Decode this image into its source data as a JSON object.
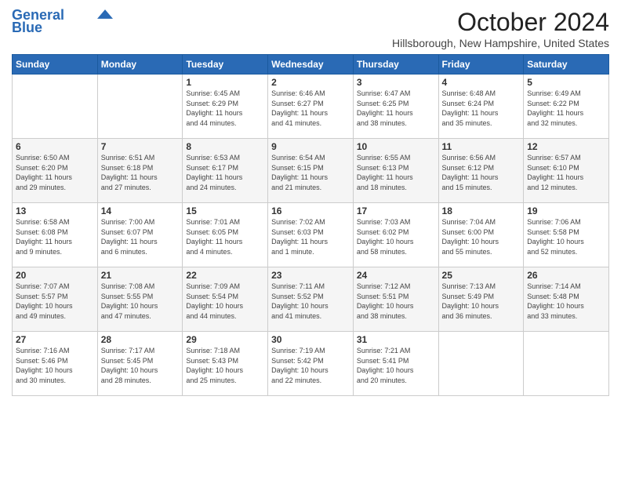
{
  "header": {
    "logo_line1": "General",
    "logo_line2": "Blue",
    "month": "October 2024",
    "location": "Hillsborough, New Hampshire, United States"
  },
  "days_of_week": [
    "Sunday",
    "Monday",
    "Tuesday",
    "Wednesday",
    "Thursday",
    "Friday",
    "Saturday"
  ],
  "weeks": [
    [
      {
        "day": "",
        "info": ""
      },
      {
        "day": "",
        "info": ""
      },
      {
        "day": "1",
        "info": "Sunrise: 6:45 AM\nSunset: 6:29 PM\nDaylight: 11 hours\nand 44 minutes."
      },
      {
        "day": "2",
        "info": "Sunrise: 6:46 AM\nSunset: 6:27 PM\nDaylight: 11 hours\nand 41 minutes."
      },
      {
        "day": "3",
        "info": "Sunrise: 6:47 AM\nSunset: 6:25 PM\nDaylight: 11 hours\nand 38 minutes."
      },
      {
        "day": "4",
        "info": "Sunrise: 6:48 AM\nSunset: 6:24 PM\nDaylight: 11 hours\nand 35 minutes."
      },
      {
        "day": "5",
        "info": "Sunrise: 6:49 AM\nSunset: 6:22 PM\nDaylight: 11 hours\nand 32 minutes."
      }
    ],
    [
      {
        "day": "6",
        "info": "Sunrise: 6:50 AM\nSunset: 6:20 PM\nDaylight: 11 hours\nand 29 minutes."
      },
      {
        "day": "7",
        "info": "Sunrise: 6:51 AM\nSunset: 6:18 PM\nDaylight: 11 hours\nand 27 minutes."
      },
      {
        "day": "8",
        "info": "Sunrise: 6:53 AM\nSunset: 6:17 PM\nDaylight: 11 hours\nand 24 minutes."
      },
      {
        "day": "9",
        "info": "Sunrise: 6:54 AM\nSunset: 6:15 PM\nDaylight: 11 hours\nand 21 minutes."
      },
      {
        "day": "10",
        "info": "Sunrise: 6:55 AM\nSunset: 6:13 PM\nDaylight: 11 hours\nand 18 minutes."
      },
      {
        "day": "11",
        "info": "Sunrise: 6:56 AM\nSunset: 6:12 PM\nDaylight: 11 hours\nand 15 minutes."
      },
      {
        "day": "12",
        "info": "Sunrise: 6:57 AM\nSunset: 6:10 PM\nDaylight: 11 hours\nand 12 minutes."
      }
    ],
    [
      {
        "day": "13",
        "info": "Sunrise: 6:58 AM\nSunset: 6:08 PM\nDaylight: 11 hours\nand 9 minutes."
      },
      {
        "day": "14",
        "info": "Sunrise: 7:00 AM\nSunset: 6:07 PM\nDaylight: 11 hours\nand 6 minutes."
      },
      {
        "day": "15",
        "info": "Sunrise: 7:01 AM\nSunset: 6:05 PM\nDaylight: 11 hours\nand 4 minutes."
      },
      {
        "day": "16",
        "info": "Sunrise: 7:02 AM\nSunset: 6:03 PM\nDaylight: 11 hours\nand 1 minute."
      },
      {
        "day": "17",
        "info": "Sunrise: 7:03 AM\nSunset: 6:02 PM\nDaylight: 10 hours\nand 58 minutes."
      },
      {
        "day": "18",
        "info": "Sunrise: 7:04 AM\nSunset: 6:00 PM\nDaylight: 10 hours\nand 55 minutes."
      },
      {
        "day": "19",
        "info": "Sunrise: 7:06 AM\nSunset: 5:58 PM\nDaylight: 10 hours\nand 52 minutes."
      }
    ],
    [
      {
        "day": "20",
        "info": "Sunrise: 7:07 AM\nSunset: 5:57 PM\nDaylight: 10 hours\nand 49 minutes."
      },
      {
        "day": "21",
        "info": "Sunrise: 7:08 AM\nSunset: 5:55 PM\nDaylight: 10 hours\nand 47 minutes."
      },
      {
        "day": "22",
        "info": "Sunrise: 7:09 AM\nSunset: 5:54 PM\nDaylight: 10 hours\nand 44 minutes."
      },
      {
        "day": "23",
        "info": "Sunrise: 7:11 AM\nSunset: 5:52 PM\nDaylight: 10 hours\nand 41 minutes."
      },
      {
        "day": "24",
        "info": "Sunrise: 7:12 AM\nSunset: 5:51 PM\nDaylight: 10 hours\nand 38 minutes."
      },
      {
        "day": "25",
        "info": "Sunrise: 7:13 AM\nSunset: 5:49 PM\nDaylight: 10 hours\nand 36 minutes."
      },
      {
        "day": "26",
        "info": "Sunrise: 7:14 AM\nSunset: 5:48 PM\nDaylight: 10 hours\nand 33 minutes."
      }
    ],
    [
      {
        "day": "27",
        "info": "Sunrise: 7:16 AM\nSunset: 5:46 PM\nDaylight: 10 hours\nand 30 minutes."
      },
      {
        "day": "28",
        "info": "Sunrise: 7:17 AM\nSunset: 5:45 PM\nDaylight: 10 hours\nand 28 minutes."
      },
      {
        "day": "29",
        "info": "Sunrise: 7:18 AM\nSunset: 5:43 PM\nDaylight: 10 hours\nand 25 minutes."
      },
      {
        "day": "30",
        "info": "Sunrise: 7:19 AM\nSunset: 5:42 PM\nDaylight: 10 hours\nand 22 minutes."
      },
      {
        "day": "31",
        "info": "Sunrise: 7:21 AM\nSunset: 5:41 PM\nDaylight: 10 hours\nand 20 minutes."
      },
      {
        "day": "",
        "info": ""
      },
      {
        "day": "",
        "info": ""
      }
    ]
  ]
}
